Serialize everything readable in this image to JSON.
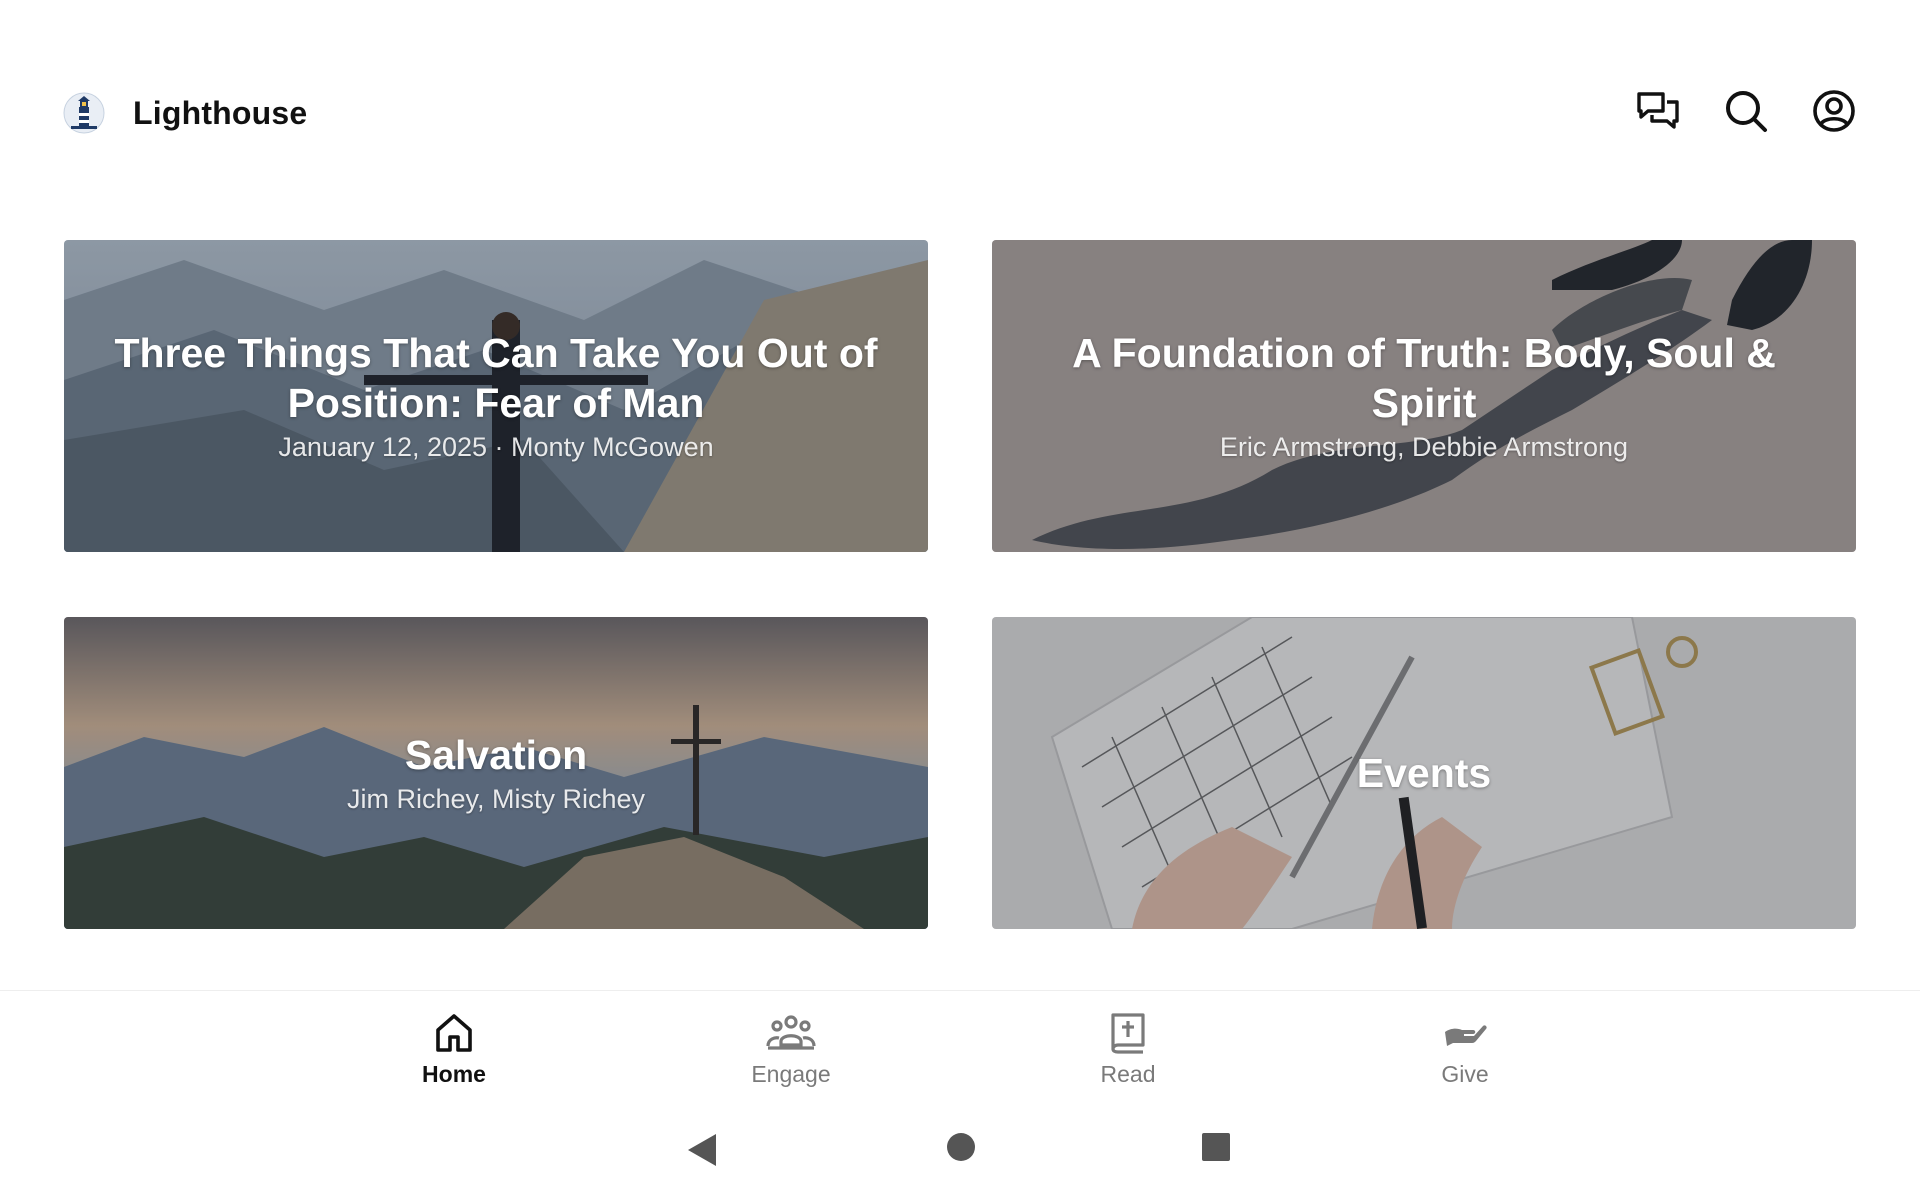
{
  "app": {
    "name": "Lighthouse",
    "logo_icon": "lighthouse-logo-icon"
  },
  "header": {
    "icons": [
      "chat-icon",
      "search-icon",
      "account-icon"
    ]
  },
  "cards": [
    {
      "title": "Three Things That Can Take You Out of Position: Fear of Man",
      "subtitle": "January 12, 2025 · Monty McGowen",
      "image": "person-arms-outstretched-on-mountain"
    },
    {
      "title": "A Foundation of Truth: Body, Soul & Spirit",
      "subtitle": "Eric Armstrong, Debbie Armstrong",
      "image": "shadow-of-person-on-ground"
    },
    {
      "title": "Salvation",
      "subtitle": "Jim Richey, Misty Richey",
      "image": "cross-on-mountain-top"
    },
    {
      "title": "Events",
      "subtitle": "",
      "image": "hands-writing-in-calendar"
    }
  ],
  "bottom_nav": {
    "active": "Home",
    "items": [
      {
        "label": "Home",
        "icon": "home-icon"
      },
      {
        "label": "Engage",
        "icon": "groups-icon"
      },
      {
        "label": "Read",
        "icon": "bible-icon"
      },
      {
        "label": "Give",
        "icon": "giving-hand-icon"
      }
    ]
  },
  "system_nav": {
    "buttons": [
      "back-icon",
      "home-circle-icon",
      "recents-icon"
    ]
  },
  "colors": {
    "active_nav": "#111111",
    "inactive_nav": "#7a7a7a",
    "card_overlay": "#282c34"
  }
}
